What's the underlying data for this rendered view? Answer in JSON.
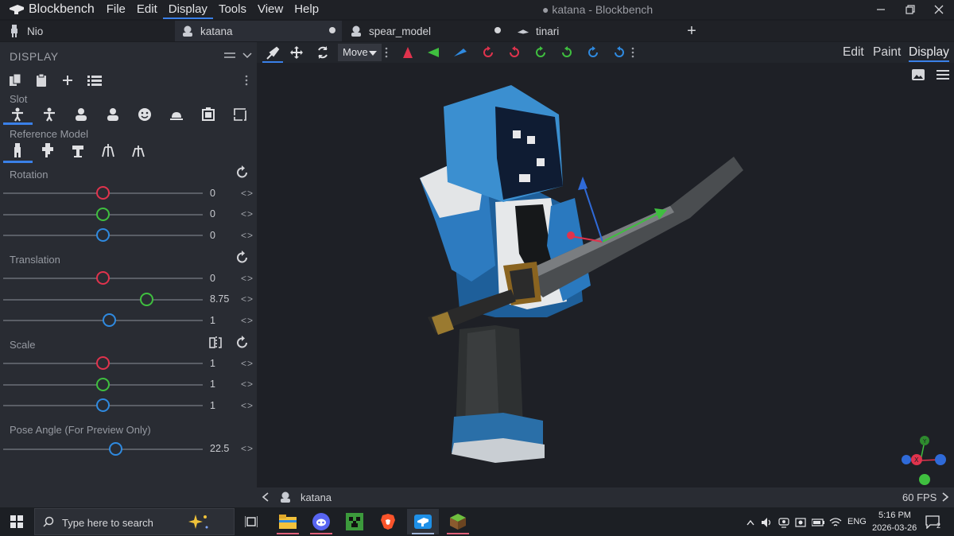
{
  "titlebar": {
    "app_name": "Blockbench",
    "window_title": "● katana - Blockbench",
    "menu": [
      "File",
      "Edit",
      "Display",
      "Tools",
      "View",
      "Help"
    ],
    "active_menu": "Display"
  },
  "tabs": [
    {
      "label": "Nio",
      "modified": false,
      "active": false
    },
    {
      "label": "katana",
      "modified": true,
      "active": true
    },
    {
      "label": "spear_model",
      "modified": true,
      "active": false
    },
    {
      "label": "tinari",
      "modified": false,
      "active": false
    }
  ],
  "panel": {
    "title": "DISPLAY",
    "slot_label": "Slot",
    "reference_label": "Reference Model",
    "rotation": {
      "label": "Rotation",
      "values": [
        "0",
        "0",
        "0"
      ],
      "levels": [
        0.5,
        0.5,
        0.5
      ]
    },
    "translation": {
      "label": "Translation",
      "values": [
        "0",
        "8.75",
        "1"
      ],
      "levels": [
        0.5,
        0.71875,
        0.53125
      ]
    },
    "scale": {
      "label": "Scale",
      "values": [
        "1",
        "1",
        "1"
      ],
      "levels": [
        0.5,
        0.5,
        0.5
      ]
    },
    "pose": {
      "label": "Pose Angle (For Preview Only)",
      "value": "22.5",
      "level": 0.5625
    }
  },
  "toolbar": {
    "tool_select": "Move",
    "modes": [
      "Edit",
      "Paint",
      "Display"
    ],
    "active_mode": "Display"
  },
  "status": {
    "model_name": "katana",
    "fps": "60 FPS"
  },
  "taskbar": {
    "search_placeholder": "Type here to search",
    "language": "ENG",
    "time": "5:16 PM",
    "date": "2026-03-26",
    "notifications": "2"
  },
  "colors": {
    "accent": "#3a80e8",
    "axis_x": "#e0334d",
    "axis_y": "#3fbf3f",
    "axis_z": "#2f8ae0"
  }
}
